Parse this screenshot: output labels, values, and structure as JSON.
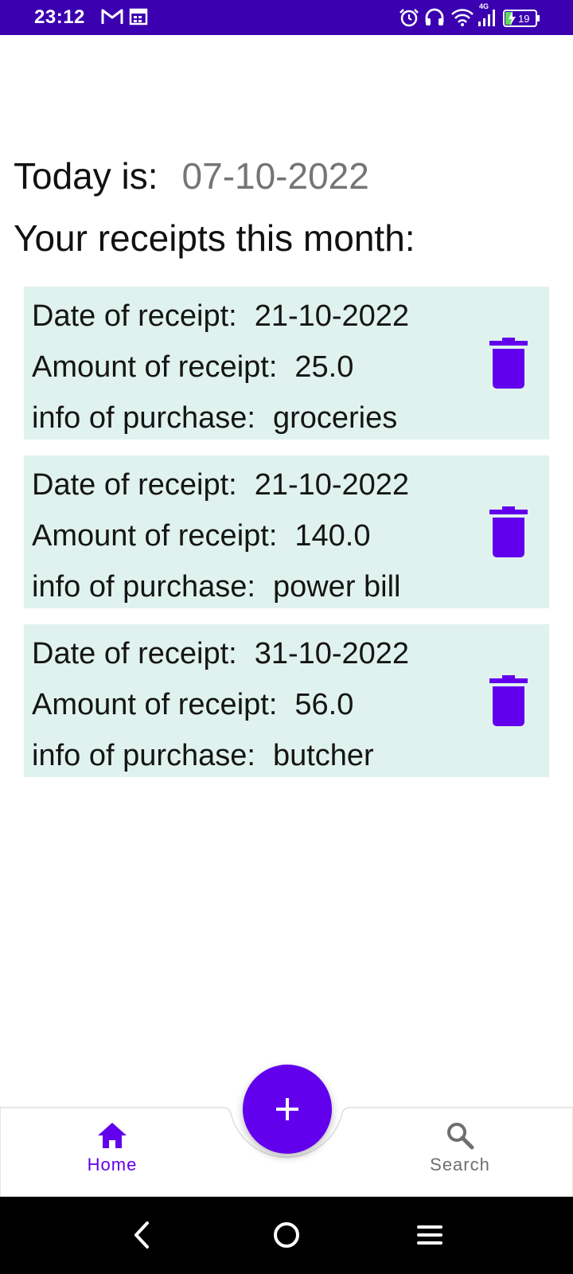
{
  "status_bar": {
    "time": "23:12",
    "network_type": "4G",
    "battery_level": "19",
    "icons": [
      "gmail-icon",
      "calendar-icon",
      "alarm-icon",
      "headset-icon",
      "wifi-icon",
      "signal-icon",
      "battery-charging-icon"
    ]
  },
  "header": {
    "today_label": "Today is:",
    "today_date": "07-10-2022",
    "month_heading": "Your receipts this month:"
  },
  "labels": {
    "date": "Date of receipt:",
    "amount": "Amount of receipt:",
    "info": "info of purchase:"
  },
  "receipts": [
    {
      "date": "21-10-2022",
      "amount": "25.0",
      "info": "groceries"
    },
    {
      "date": "21-10-2022",
      "amount": "140.0",
      "info": "power bill"
    },
    {
      "date": "31-10-2022",
      "amount": "56.0",
      "info": "butcher"
    }
  ],
  "bottom_nav": {
    "home_label": "Home",
    "search_label": "Search",
    "fab_icon": "plus-icon"
  },
  "colors": {
    "accent": "#6200ee",
    "status_bar": "#3b00b0",
    "card_background": "#e0f2ee",
    "date_gray": "#757575"
  }
}
